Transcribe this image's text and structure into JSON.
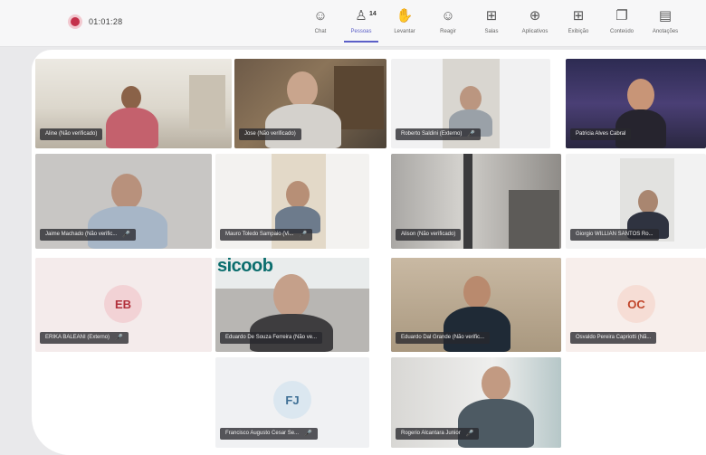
{
  "meeting": {
    "elapsed": "01:01:28"
  },
  "toolbar": [
    {
      "id": "chat",
      "label": "Chat",
      "icon": "chat-icon",
      "glyph": "☺",
      "active": false
    },
    {
      "id": "people",
      "label": "Pessoas",
      "icon": "people-icon",
      "glyph": "♙",
      "count": "14",
      "active": true
    },
    {
      "id": "raise",
      "label": "Levantar",
      "icon": "raise-hand-icon",
      "glyph": "✋",
      "active": false
    },
    {
      "id": "react",
      "label": "Reagir",
      "icon": "react-icon",
      "glyph": "☺",
      "active": false
    },
    {
      "id": "rooms",
      "label": "Salas",
      "icon": "rooms-icon",
      "glyph": "⊞",
      "active": false
    },
    {
      "id": "apps",
      "label": "Aplicativos",
      "icon": "apps-icon",
      "glyph": "⊕",
      "active": false
    },
    {
      "id": "view",
      "label": "Exibição",
      "icon": "view-icon",
      "glyph": "⊞",
      "active": false
    },
    {
      "id": "more",
      "label": "Conteúdo",
      "icon": "content-icon",
      "glyph": "❐",
      "active": false
    },
    {
      "id": "notes",
      "label": "Anotações",
      "icon": "notes-icon",
      "glyph": "▤",
      "active": false
    }
  ],
  "participants": [
    {
      "name": "Aline (Não verificado)",
      "mic": "",
      "avatar": ""
    },
    {
      "name": "Jose (Não verificado)",
      "mic": "",
      "avatar": ""
    },
    {
      "name": "Roberto Saldini (Externo)",
      "mic": "🎤",
      "avatar": ""
    },
    {
      "name": "Patricia Alves Cabral",
      "mic": "",
      "avatar": ""
    },
    {
      "name": "Jaime Machado (Não verific...",
      "mic": "🎤",
      "avatar": ""
    },
    {
      "name": "Mauro Toledo Sampaio (Vi...",
      "mic": "🎤",
      "avatar": ""
    },
    {
      "name": "Alison (Não verificado)",
      "mic": "",
      "avatar": ""
    },
    {
      "name": "Giorgio WILLIAN SANTOS Ro...",
      "mic": "",
      "avatar": ""
    },
    {
      "name": "ERIKA BALEANI (Externo)",
      "mic": "🎤",
      "avatar": "EB"
    },
    {
      "name": "Eduardo De Souza Ferreira (Não ve...",
      "mic": "",
      "avatar": ""
    },
    {
      "name": "Eduardo Dal Grande (Não verific...",
      "mic": "",
      "avatar": ""
    },
    {
      "name": "Osvaldo Pereira Capriotti (Nã...",
      "mic": "",
      "avatar": "OC"
    },
    {
      "name": "Francisco Augusto Cesar Se...",
      "mic": "🎤",
      "avatar": "FJ"
    },
    {
      "name": "Rogerio Alcantara Junior",
      "mic": "🎤",
      "avatar": ""
    }
  ],
  "wall_text": {
    "sicoob": "sicoob"
  },
  "colors": {
    "accent": "#5b5fc7",
    "eb_bg": "#f2d2d5",
    "eb_fg": "#b1303b",
    "oc_bg": "#f6ddd5",
    "oc_fg": "#c0452a",
    "fj_bg": "#dbe7f0",
    "fj_fg": "#3e6f95"
  }
}
